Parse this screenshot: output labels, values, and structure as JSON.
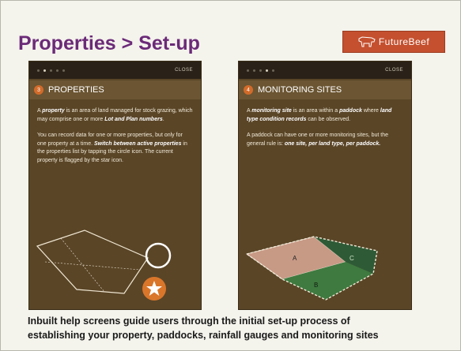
{
  "slide": {
    "title": "Properties > Set-up",
    "logo_text": "FutureBeef",
    "caption_line1": "Inbuilt help screens guide users through the initial set-up process of",
    "caption_line2": "establishing your property, paddocks, rainfall gauges and monitoring sites"
  },
  "panels": [
    {
      "close_label": "CLOSE",
      "step": "3",
      "title": "PROPERTIES",
      "p1_pre": "A ",
      "p1_em1": "property",
      "p1_mid": " is an area of land managed for stock grazing, which may comprise one or more ",
      "p1_em2": "Lot and Plan numbers",
      "p1_end": ".",
      "p2_pre": "You can record data for one or more properties, but only for one property at a time. ",
      "p2_em": "Switch between active properties",
      "p2_mid": " in the properties list by tapping the circle icon. The current property is flagged by the star icon."
    },
    {
      "close_label": "CLOSE",
      "step": "4",
      "title": "MONITORING SITES",
      "p1_pre": "A ",
      "p1_em1": "monitoring site",
      "p1_mid": " is an area within a ",
      "p1_em2": "paddock",
      "p1_mid2": " where ",
      "p1_em3": "land type condition records",
      "p1_end": " can be observed.",
      "p2_pre": "A paddock can have one or more monitoring sites, but the general rule is: ",
      "p2_em": "one site, per land type, per paddock.",
      "label_a": "A",
      "label_b": "B",
      "label_c": "C"
    }
  ],
  "colors": {
    "title": "#6b2a78",
    "logo_bg": "#c4502f",
    "phone_bg": "#5a4527",
    "badge": "#d26b2a"
  },
  "icons": [
    "cow-logo-icon",
    "star-icon",
    "circle-icon"
  ]
}
